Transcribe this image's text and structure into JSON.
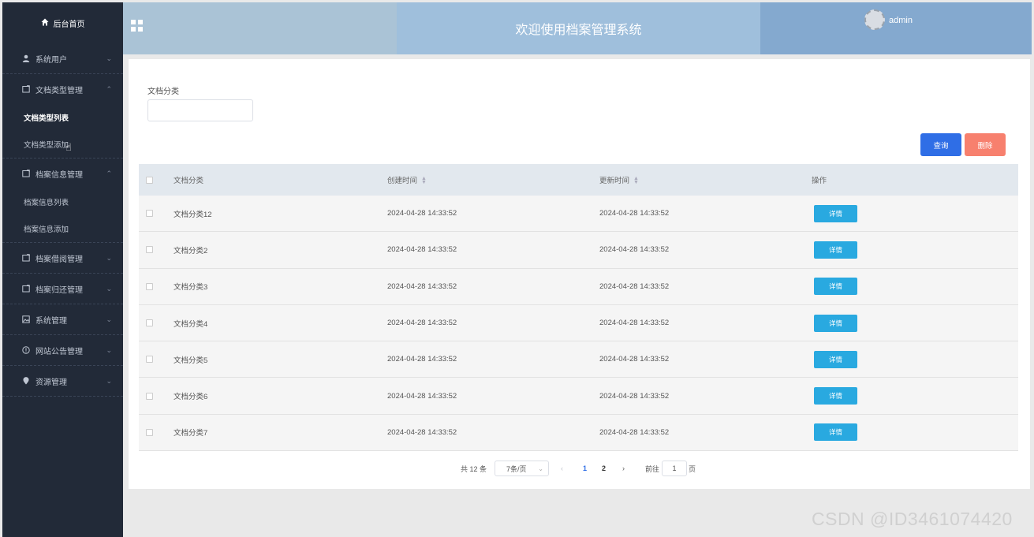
{
  "sidebar": {
    "home": "后台首页",
    "items": [
      {
        "label": "系统用户",
        "icon": "user-icon",
        "expanded": false
      },
      {
        "label": "文档类型管理",
        "icon": "folder-icon",
        "expanded": true,
        "subs": [
          "文档类型列表",
          "文档类型添加"
        ],
        "active_sub": 0
      },
      {
        "label": "档案信息管理",
        "icon": "folder-icon",
        "expanded": true,
        "subs": [
          "档案信息列表",
          "档案信息添加"
        ]
      },
      {
        "label": "档案借阅管理",
        "icon": "folder-icon",
        "expanded": false
      },
      {
        "label": "档案归还管理",
        "icon": "folder-icon",
        "expanded": false
      },
      {
        "label": "系统管理",
        "icon": "image-icon",
        "expanded": false
      },
      {
        "label": "网站公告管理",
        "icon": "info-circle-icon",
        "expanded": false
      },
      {
        "label": "资源管理",
        "icon": "location-pin-icon",
        "expanded": false
      }
    ]
  },
  "header": {
    "title": "欢迎使用档案管理系统",
    "username": "admin"
  },
  "search": {
    "label": "文档分类",
    "value": "",
    "query_label": "查询",
    "delete_label": "删除"
  },
  "table": {
    "columns": [
      "文档分类",
      "创建时间",
      "更新时间",
      "操作"
    ],
    "detail_label": "详情",
    "rows": [
      {
        "name": "文档分类12",
        "created": "2024-04-28 14:33:52",
        "updated": "2024-04-28 14:33:52"
      },
      {
        "name": "文档分类2",
        "created": "2024-04-28 14:33:52",
        "updated": "2024-04-28 14:33:52"
      },
      {
        "name": "文档分类3",
        "created": "2024-04-28 14:33:52",
        "updated": "2024-04-28 14:33:52"
      },
      {
        "name": "文档分类4",
        "created": "2024-04-28 14:33:52",
        "updated": "2024-04-28 14:33:52"
      },
      {
        "name": "文档分类5",
        "created": "2024-04-28 14:33:52",
        "updated": "2024-04-28 14:33:52"
      },
      {
        "name": "文档分类6",
        "created": "2024-04-28 14:33:52",
        "updated": "2024-04-28 14:33:52"
      },
      {
        "name": "文档分类7",
        "created": "2024-04-28 14:33:52",
        "updated": "2024-04-28 14:33:52"
      }
    ]
  },
  "pagination": {
    "total": "共 12 条",
    "page_size": "7条/页",
    "pages": [
      "1",
      "2"
    ],
    "current": "1",
    "goto_prefix": "前往",
    "goto_value": "1",
    "goto_suffix": "页"
  },
  "watermark": "CSDN @ID3461074420",
  "colors": {
    "sidebar_bg": "#222a38",
    "primary": "#2f6ee6",
    "danger": "#f7806e",
    "detail": "#29a9e0"
  }
}
